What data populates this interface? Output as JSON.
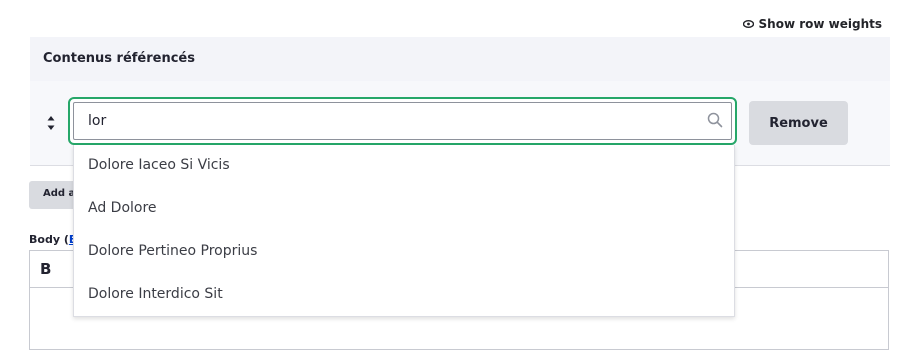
{
  "header": {
    "row_weights_label": "Show row weights"
  },
  "table": {
    "title": "Contenus référencés"
  },
  "field": {
    "input_value": "lor",
    "remove_label": "Remove"
  },
  "add_button": {
    "label": "Add another item"
  },
  "body_field": {
    "label": "Body (",
    "link_text": "E"
  },
  "editor": {
    "bold_label": "B"
  },
  "autocomplete": {
    "items": [
      {
        "label": "Dolore Iaceo Si Vicis"
      },
      {
        "label": "Ad Dolore"
      },
      {
        "label": "Dolore Pertineo Proprius"
      },
      {
        "label": "Dolore Interdico Sit"
      }
    ]
  },
  "colors": {
    "focus": "#26a769",
    "header_bg": "#f3f4f9",
    "button_bg": "#d9dbe0"
  }
}
